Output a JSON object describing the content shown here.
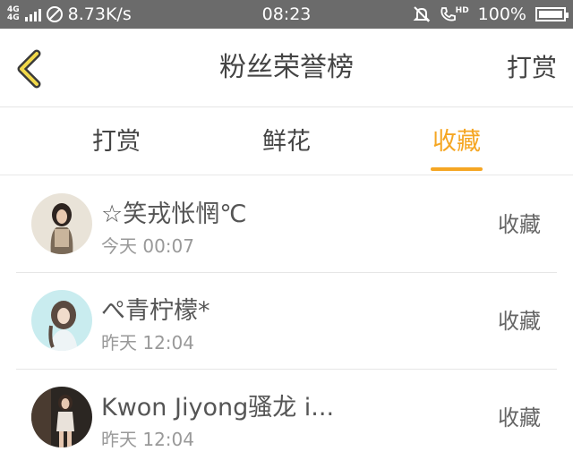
{
  "status_bar": {
    "network_type_top": "4G",
    "network_type_bottom": "4G",
    "speed": "8.73K/s",
    "time": "08:23",
    "call_badge": "HD",
    "battery": "100%",
    "battery_level": 1.0
  },
  "header": {
    "title": "粉丝荣誉榜",
    "action_label": "打赏"
  },
  "tabs": [
    {
      "label": "打赏",
      "active": false
    },
    {
      "label": "鲜花",
      "active": false
    },
    {
      "label": "收藏",
      "active": true
    }
  ],
  "accent_color": "#f5a623",
  "list": [
    {
      "name": "☆笑戎怅惘℃",
      "time": "今天 00:07",
      "status": "收藏"
    },
    {
      "name": "ぺ青柠檬*",
      "time": "昨天 12:04",
      "status": "收藏"
    },
    {
      "name": "Kwon Jiyong骚龙 i...",
      "time": "昨天 12:04",
      "status": "收藏"
    }
  ]
}
